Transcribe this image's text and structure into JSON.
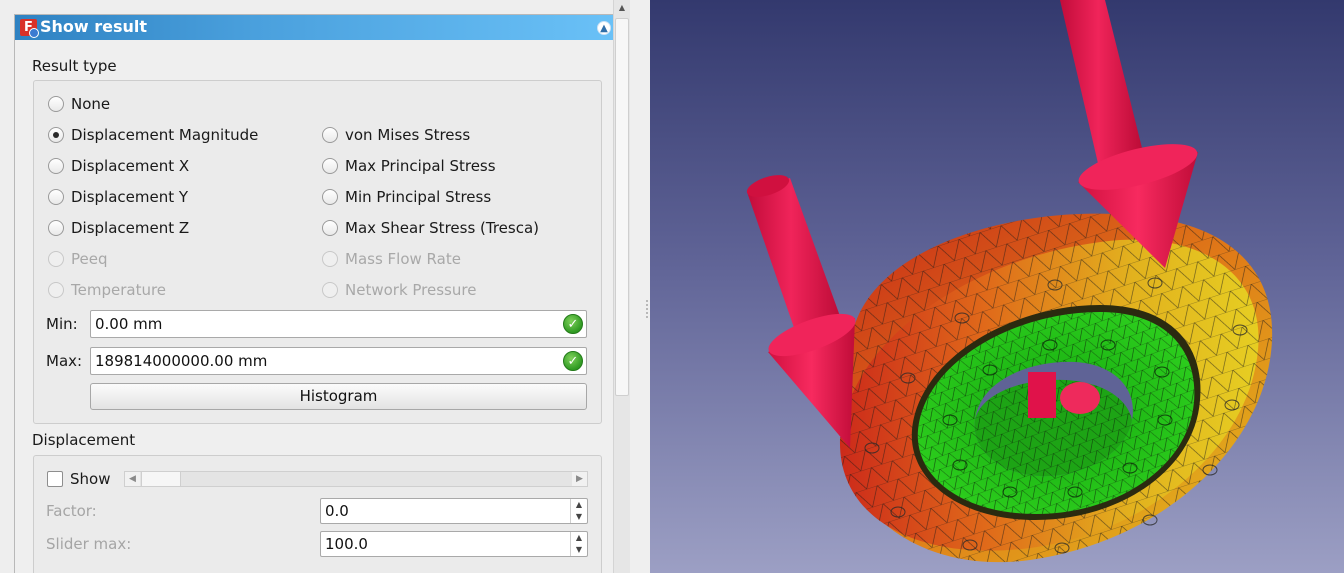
{
  "panel": {
    "title": "Show result",
    "logo_glyph": "F",
    "collapse_icon": "double-chevron-up-icon"
  },
  "result_type": {
    "section_label": "Result type",
    "options": [
      {
        "label": "None",
        "checked": false,
        "enabled": true
      },
      {
        "label": "Displacement Magnitude",
        "checked": true,
        "enabled": true
      },
      {
        "label": "von Mises Stress",
        "checked": false,
        "enabled": true
      },
      {
        "label": "Displacement X",
        "checked": false,
        "enabled": true
      },
      {
        "label": "Max Principal Stress",
        "checked": false,
        "enabled": true
      },
      {
        "label": "Displacement Y",
        "checked": false,
        "enabled": true
      },
      {
        "label": "Min Principal Stress",
        "checked": false,
        "enabled": true
      },
      {
        "label": "Displacement Z",
        "checked": false,
        "enabled": true
      },
      {
        "label": "Max Shear Stress (Tresca)",
        "checked": false,
        "enabled": true
      },
      {
        "label": "Peeq",
        "checked": false,
        "enabled": false
      },
      {
        "label": "Mass Flow Rate",
        "checked": false,
        "enabled": false
      },
      {
        "label": "Temperature",
        "checked": false,
        "enabled": false
      },
      {
        "label": "Network Pressure",
        "checked": false,
        "enabled": false
      }
    ],
    "min_label": "Min:",
    "min_value": "0.00 mm",
    "max_label": "Max:",
    "max_value": "189814000000.00 mm",
    "histogram_label": "Histogram"
  },
  "displacement": {
    "section_label": "Displacement",
    "show_label": "Show",
    "show_checked": false,
    "factor_label": "Factor:",
    "factor_value": "0.0",
    "slider_max_label": "Slider max:",
    "slider_max_value": "100.0"
  },
  "viewport": {
    "background_top": "#33396e",
    "background_bottom": "#9c9fc4",
    "arrow_color": "#e8134a",
    "mesh_colors": [
      "#22c21a",
      "#e8c21e",
      "#e07a18",
      "#d8321c"
    ]
  }
}
